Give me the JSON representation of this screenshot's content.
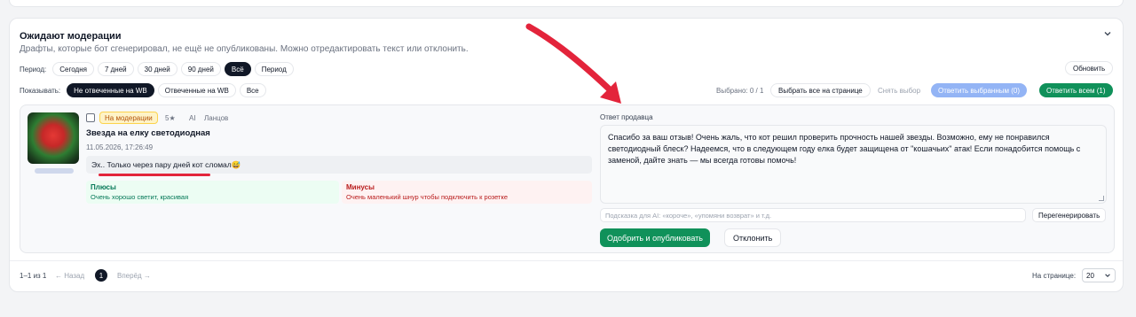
{
  "section": {
    "title": "Ожидают модерации",
    "subtitle": "Драфты, которые бот сгенерировал, не ещё не опубликованы. Можно отредактировать текст или отклонить."
  },
  "period": {
    "label": "Период:",
    "options": [
      "Сегодня",
      "7 дней",
      "30 дней",
      "90 дней",
      "Всё",
      "Период"
    ],
    "selected": "Всё"
  },
  "refresh_label": "Обновить",
  "show": {
    "label": "Показывать:",
    "options": [
      "Не отвеченные на WB",
      "Отвеченные на WB",
      "Все"
    ],
    "selected": "Не отвеченные на WB"
  },
  "selection": {
    "count_text": "Выбрано: 0 / 1",
    "select_all": "Выбрать все на странице",
    "clear": "Снять выбор",
    "reply_selected": "Ответить выбранным (0)",
    "reply_all": "Ответить всем (1)"
  },
  "review": {
    "status": "На модерации",
    "rating": "5★",
    "ai": "AI",
    "author": "Ланцов",
    "product": "Звезда на елку светодиодная",
    "date": "11.05.2026, 17:26:49",
    "text": "Эх.. Только через пару дней кот сломал😅",
    "pros_title": "Плюсы",
    "pros_text": "Очень хорошо светит, красивая",
    "cons_title": "Минусы",
    "cons_text": "Очень маленький шнур чтобы подключить к розетке"
  },
  "answer": {
    "label": "Ответ продавца",
    "text": "Спасибо за ваш отзыв! Очень жаль, что кот решил проверить прочность нашей звезды. Возможно, ему не понравился светодиодный блеск? Надеемся, что в следующем году елка будет защищена от \"кошачьих\" атак! Если понадобится помощь с заменой, дайте знать — мы всегда готовы помочь!",
    "hint_placeholder": "Подсказка для AI: «короче», «упомяни возврат» и т.д.",
    "regenerate": "Перегенерировать",
    "approve": "Одобрить и опубликовать",
    "reject": "Отклонить"
  },
  "pagination": {
    "range": "1–1 из 1",
    "prev": "← Назад",
    "page": "1",
    "next": "Вперёд →",
    "per_page_label": "На странице:",
    "per_page_value": "20"
  },
  "colors": {
    "accent_green": "#10915a",
    "accent_blue": "#93b4f5",
    "annotation_red": "#e3243b"
  }
}
